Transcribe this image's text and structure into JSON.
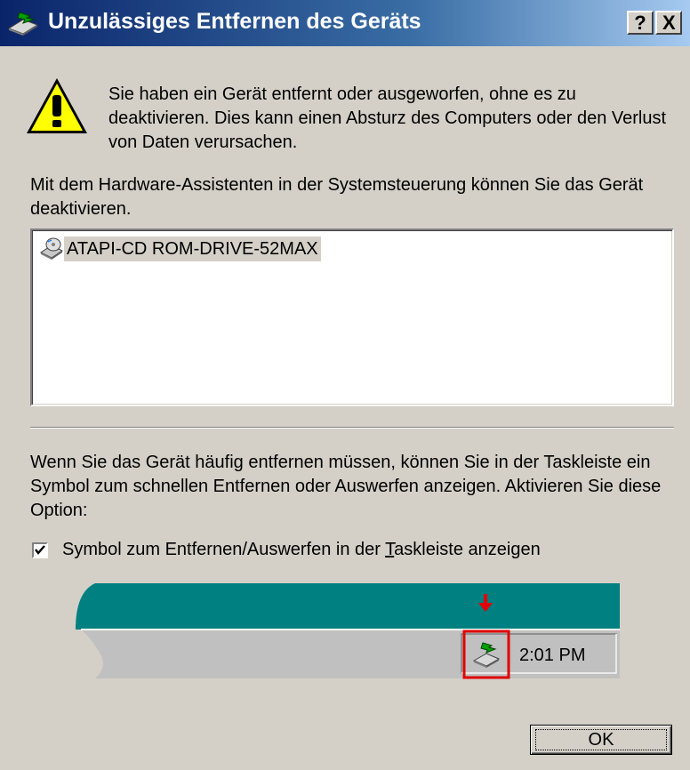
{
  "window": {
    "title": "Unzulässiges Entfernen des Geräts",
    "help_button": "?",
    "close_button": "X",
    "title_icon": "eject-hardware-icon"
  },
  "warning": {
    "icon": "warning-icon",
    "text": "Sie haben ein Gerät entfernt oder ausgeworfen, ohne es zu deaktivieren. Dies kann einen Absturz des Computers oder den Verlust von Daten verursachen."
  },
  "hardware_info": "Mit dem Hardware-Assistenten in der Systemsteuerung können Sie das Gerät deaktivieren.",
  "device_list": {
    "items": [
      {
        "label": "ATAPI-CD ROM-DRIVE-52MAX",
        "icon": "cd-drive-icon"
      }
    ]
  },
  "option_text": "Wenn Sie das Gerät häufig entfernen müssen, können Sie in der Taskleiste ein Symbol zum schnellen Entfernen oder Auswerfen anzeigen. Aktivieren Sie diese Option:",
  "checkbox": {
    "checked": true,
    "label_before": "Symbol zum Entfernen/Auswerfen in der ",
    "label_mnemonic": "T",
    "label_after": "askleiste anzeigen"
  },
  "taskbar_preview": {
    "clock": "2:01 PM",
    "tray_icon": "eject-hardware-icon",
    "arrow_color": "#e00000",
    "taskbar_color": "#008080"
  },
  "buttons": {
    "ok": "OK"
  }
}
